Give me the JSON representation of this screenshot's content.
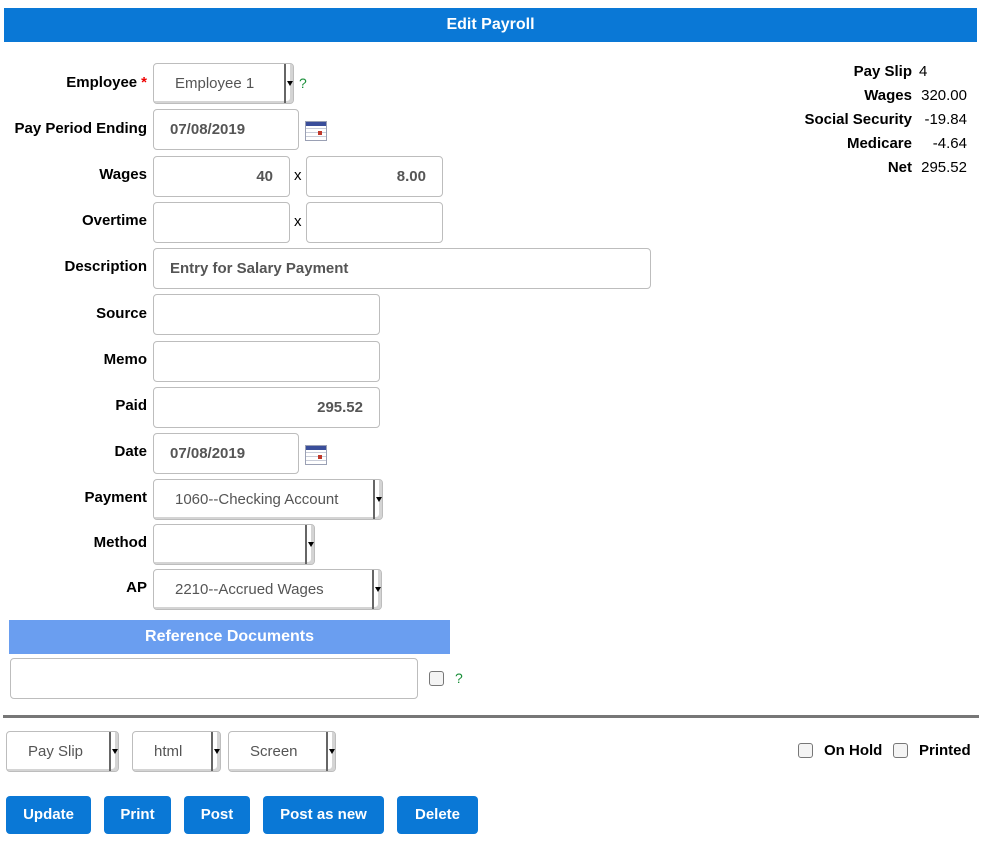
{
  "title": "Edit Payroll",
  "form": {
    "employee": {
      "label": "Employee",
      "required": "*",
      "value": "Employee 1",
      "help": "?"
    },
    "pay_period_ending": {
      "label": "Pay Period Ending",
      "value": "07/08/2019"
    },
    "wages": {
      "label": "Wages",
      "hours": "40",
      "times": "x",
      "rate": "8.00"
    },
    "overtime": {
      "label": "Overtime",
      "hours": "",
      "times": "x",
      "rate": ""
    },
    "description": {
      "label": "Description",
      "value": "Entry for Salary Payment"
    },
    "source": {
      "label": "Source",
      "value": ""
    },
    "memo": {
      "label": "Memo",
      "value": ""
    },
    "paid": {
      "label": "Paid",
      "value": "295.52"
    },
    "date": {
      "label": "Date",
      "value": "07/08/2019"
    },
    "payment": {
      "label": "Payment",
      "value": "1060--Checking Account"
    },
    "method": {
      "label": "Method",
      "value": ""
    },
    "ap": {
      "label": "AP",
      "value": "2210--Accrued Wages"
    }
  },
  "summary": [
    {
      "key": "Pay Slip",
      "value": "4"
    },
    {
      "key": "Wages",
      "value": "320.00"
    },
    {
      "key": "Social Security",
      "value": "-19.84"
    },
    {
      "key": "Medicare",
      "value": "-4.64"
    },
    {
      "key": "Net",
      "value": "295.52"
    }
  ],
  "reference_documents": {
    "title": "Reference Documents",
    "value": "",
    "help": "?"
  },
  "print_options": {
    "template": "Pay Slip",
    "format": "html",
    "media": "Screen",
    "on_hold": "On Hold",
    "printed": "Printed"
  },
  "buttons": {
    "update": "Update",
    "print": "Print",
    "post": "Post",
    "post_as_new": "Post as new",
    "delete": "Delete"
  },
  "colors": {
    "header": "#0a78d6",
    "subheader": "#6a9ef0",
    "button": "#0a78d6",
    "help": "#1a8f3a"
  }
}
